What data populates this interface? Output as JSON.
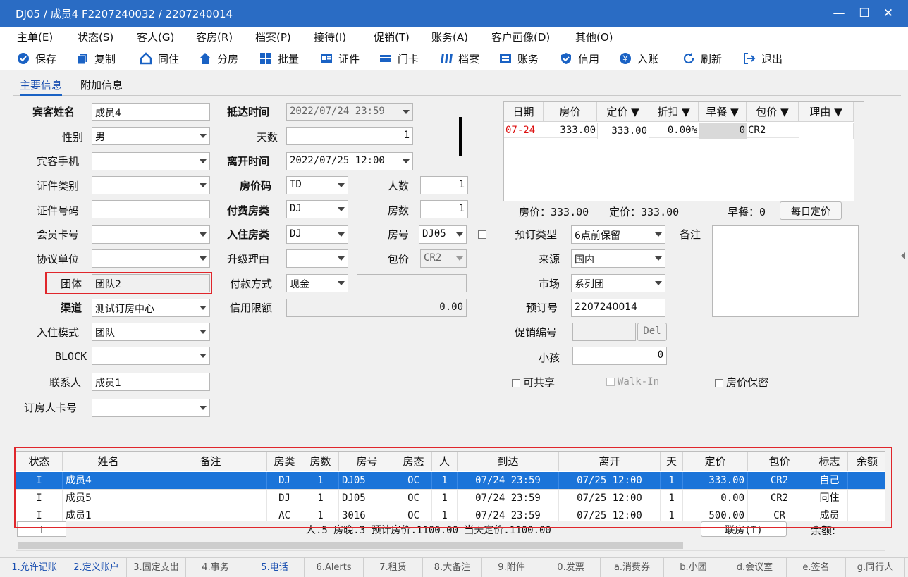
{
  "window": {
    "title": "DJ05 / 成员4 F2207240032 / 2207240014",
    "min": "—",
    "max": "☐",
    "close": "✕"
  },
  "menu": [
    "主单(E)",
    "状态(S)",
    "客人(G)",
    "客房(R)",
    "档案(P)",
    "接待(I)",
    "促销(T)",
    "账务(A)",
    "客户画像(D)",
    "其他(O)"
  ],
  "toolbar": {
    "save": "保存",
    "copy": "复制",
    "share": "同住",
    "split": "分房",
    "batch": "批量",
    "id": "证件",
    "card": "门卡",
    "profile": "档案",
    "account": "账务",
    "credit": "信用",
    "post": "入账",
    "refresh": "刷新",
    "exit": "退出"
  },
  "tabs": {
    "main": "主要信息",
    "extra": "附加信息"
  },
  "form": {
    "guest_name_label": "宾客姓名",
    "guest_name": "成员4",
    "gender_label": "性别",
    "gender": "男",
    "phone_label": "宾客手机",
    "phone": "",
    "idtype_label": "证件类别",
    "idtype": "",
    "idno_label": "证件号码",
    "idno": "",
    "member_label": "会员卡号",
    "member": "",
    "agreement_label": "协议单位",
    "agreement": "",
    "group_label": "团体",
    "group": "团队2",
    "channel_label": "渠道",
    "channel": "测试订房中心",
    "mode_label": "入住模式",
    "mode": "团队",
    "block_label": "BLOCK",
    "block": "",
    "contact_label": "联系人",
    "contact": "成员1",
    "booker_label": "订房人卡号",
    "booker": "",
    "arrival_label": "抵达时间",
    "arrival": "2022/07/24 23:59",
    "days_label": "天数",
    "days": "1",
    "depart_label": "离开时间",
    "depart": "2022/07/25 12:00",
    "ratecode_label": "房价码",
    "ratecode": "TD",
    "persons_label": "人数",
    "persons": "1",
    "paytype_label": "付费房类",
    "paytype": "DJ",
    "rooms_label": "房数",
    "rooms": "1",
    "roomtype_label": "入住房类",
    "roomtype": "DJ",
    "roomno_label": "房号",
    "roomno": "DJ05",
    "upgrade_label": "升级理由",
    "upgrade": "",
    "package_label": "包价",
    "package": "CR2",
    "payment_label": "付款方式",
    "payment": "现金",
    "payment_extra": "",
    "credit_label": "信用限额",
    "credit": "0.00",
    "booktype_label": "预订类型",
    "booktype": "6点前保留",
    "source_label": "来源",
    "source": "国内",
    "market_label": "市场",
    "market": "系列团",
    "bookno_label": "预订号",
    "bookno": "2207240014",
    "promo_label": "促销编号",
    "promo": "",
    "del_button": "Del",
    "child_label": "小孩",
    "child": "0",
    "remark_label": "备注",
    "remark": "",
    "shareable_label": "可共享",
    "walkin_label": "Walk-In",
    "secret_label": "房价保密"
  },
  "rate_grid": {
    "headers": [
      "日期",
      "房价",
      "定价 ▼",
      "折扣 ▼",
      "早餐 ▼",
      "包价 ▼",
      "理由 ▼"
    ],
    "rows": [
      {
        "date": "07-24",
        "rate": "333.00",
        "fixed": "333.00",
        "disc": "0.00%",
        "bf": "0",
        "pkg": "CR2",
        "reason": ""
      }
    ],
    "summary_rate": "房价：333.00",
    "summary_fixed": "定价：333.00",
    "summary_bf": "早餐：0",
    "daily_button": "每日定价"
  },
  "list": {
    "headers": [
      "状态",
      "姓名",
      "备注",
      "房类",
      "房数",
      "房号",
      "房态",
      "人",
      "到达",
      "离开",
      "天",
      "定价",
      "包价",
      "标志",
      "余额"
    ],
    "rows": [
      {
        "st": "I",
        "name": "成员4",
        "note": "",
        "rt": "DJ",
        "rn": "1",
        "no": "DJ05",
        "rs": "OC",
        "p": "1",
        "arr": "07/24 23:59",
        "dep": "07/25 12:00",
        "d": "1",
        "price": "333.00",
        "pkg": "CR2",
        "flag": "自己"
      },
      {
        "st": "I",
        "name": "成员5",
        "note": "",
        "rt": "DJ",
        "rn": "1",
        "no": "DJ05",
        "rs": "OC",
        "p": "1",
        "arr": "07/24 23:59",
        "dep": "07/25 12:00",
        "d": "1",
        "price": "0.00",
        "pkg": "CR2",
        "flag": "同住"
      },
      {
        "st": "I",
        "name": "成员1",
        "note": "",
        "rt": "AC",
        "rn": "1",
        "no": "3016",
        "rs": "OC",
        "p": "1",
        "arr": "07/24 23:59",
        "dep": "07/25 12:00",
        "d": "1",
        "price": "500.00",
        "pkg": "CR",
        "flag": "成员"
      }
    ],
    "footer_stats": "人.5  房晚.3  预计房价.1100.00  当天定价.1100.00",
    "link_button": "联房(T)",
    "balance_label": "余额:"
  },
  "bottom_tabs": [
    "1.允许记账",
    "2.定义账户",
    "3.固定支出",
    "4.事务",
    "5.电话",
    "6.Alerts",
    "7.租赁",
    "8.大备注",
    "9.附件",
    "0.发票",
    "a.消费券",
    "b.小团",
    "d.会议室",
    "e.签名",
    "g.同行人"
  ],
  "colors": {
    "title": "#2a6cc4",
    "selected": "#1b74d9",
    "highlight": "#e0262b",
    "link": "#1a4fb0"
  }
}
